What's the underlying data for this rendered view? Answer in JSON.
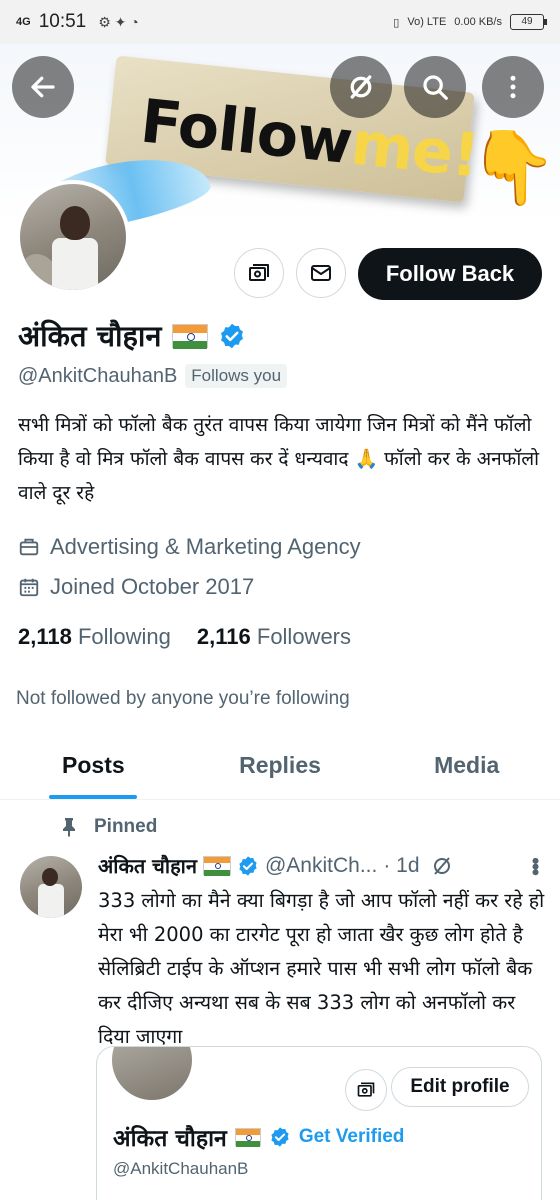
{
  "status_bar": {
    "network": "4G",
    "time": "10:51",
    "lte_label": "Vo) LTE",
    "speed": "0.00 KB/s",
    "battery": "49"
  },
  "header": {
    "back_icon": "arrow-left-icon",
    "visibility_icon": "eye-slash-icon",
    "search_icon": "search-icon",
    "more_icon": "more-vertical-icon",
    "banner_text_main": "Follow",
    "banner_text_accent": "me!"
  },
  "profile": {
    "name": "अंकित चौहान",
    "handle": "@AnkitChauhanB",
    "follows_you": "Follows you",
    "follow_back_label": "Follow Back",
    "bio": "सभी मित्रों को फॉलो बैक तुरंत वापस किया जायेगा  जिन मित्रों को मैंने फॉलो किया है वो मित्र फॉलो बैक वापस कर दें धन्यवाद 🙏  फॉलो कर के अनफॉलो वाले दूर रहे",
    "category": "Advertising & Marketing Agency",
    "joined": "Joined October 2017",
    "following_count": "2,118",
    "following_label": "Following",
    "followers_count": "2,116",
    "followers_label": "Followers",
    "not_followed": "Not followed by anyone you’re following"
  },
  "tabs": [
    {
      "label": "Posts",
      "active": true
    },
    {
      "label": "Replies",
      "active": false
    },
    {
      "label": "Media",
      "active": false
    }
  ],
  "pinned_post": {
    "pinned_label": "Pinned",
    "author_name": "अंकित चौहान",
    "author_handle": "@AnkitCh...",
    "time": "· 1d",
    "text": "333 लोगो का मैने क्या बिगड़ा है जो आप फॉलो नहीं कर रहे हो मेरा भी 2000 का टारगेट पूरा हो जाता खैर कुछ लोग होते है सेलिब्रिटी टाईप के ऑप्शन हमारे पास भी सभी लोग फॉलो बैक कर दीजिए अन्यथा सब के सब 333 लोग को अनफॉलो कर दिया जाएगा",
    "card": {
      "edit_profile_label": "Edit profile",
      "name": "अंकित चौहान",
      "get_verified_label": "Get Verified",
      "handle": "@AnkitChauhanB"
    }
  },
  "colors": {
    "accent": "#1d9bf0",
    "primary_text": "#0f1419",
    "secondary_text": "#536471",
    "button_dark": "#0f1419"
  }
}
